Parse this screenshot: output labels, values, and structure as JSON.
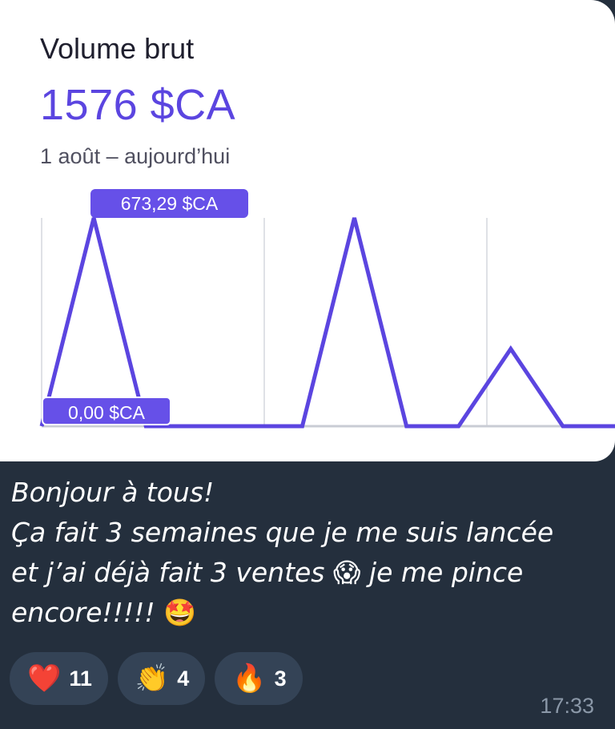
{
  "card": {
    "title": "Volume brut",
    "amount": "1576 $CA",
    "date_range": "1 août – aujourd’hui",
    "max_label": "673,29 $CA",
    "min_label": "0,00 $CA",
    "accent_color": "#5b45e0"
  },
  "chart_data": {
    "type": "line",
    "values": [
      0,
      673.29,
      0,
      0,
      0,
      0,
      673.29,
      0,
      0,
      250,
      0,
      0
    ],
    "ylim": [
      0,
      673.29
    ],
    "grid": "vertical"
  },
  "message": {
    "lines": [
      "Bonjour à tous!",
      "Ça fait 3 semaines que je me suis lancée",
      "et j’ai déjà fait 3 ventes",
      "je me pince",
      "encore!!!!!"
    ],
    "emoji_shocked": "😱",
    "emoji_starstruck": "🤩",
    "time": "17:33"
  },
  "reactions": [
    {
      "icon": "heart-icon",
      "glyph": "❤️",
      "count": "11"
    },
    {
      "icon": "clapping-hands-icon",
      "glyph": "👏",
      "count": "4"
    },
    {
      "icon": "fire-icon",
      "glyph": "🔥",
      "count": "3"
    }
  ]
}
